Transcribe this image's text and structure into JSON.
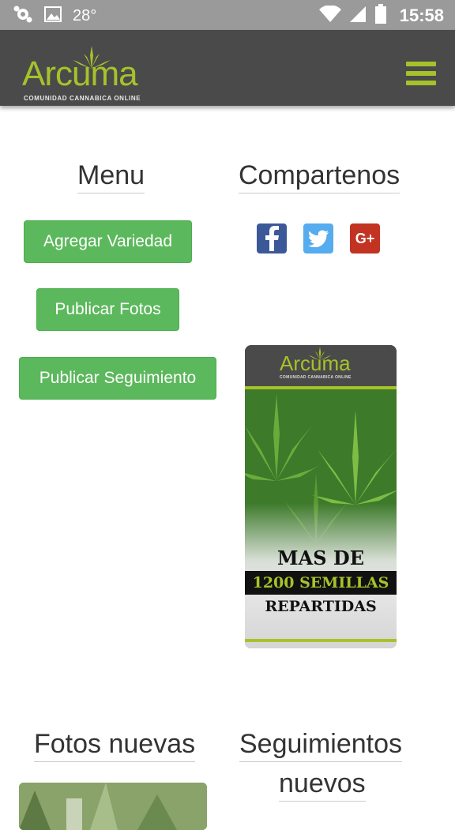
{
  "status_bar": {
    "temperature": "28°",
    "time": "15:58",
    "icons": [
      "app-notification-icon",
      "image-icon",
      "wifi-icon",
      "signal-icon",
      "battery-icon"
    ]
  },
  "header": {
    "logo_word": "Arcuma",
    "logo_tagline": "COMUNIDAD CANNABICA ONLINE",
    "menu_icon": "hamburger-menu-icon"
  },
  "menu": {
    "title": "Menu",
    "buttons": [
      "Agregar Variedad",
      "Publicar Fotos",
      "Publicar Seguimiento"
    ]
  },
  "share": {
    "title": "Compartenos",
    "networks": [
      "facebook-icon",
      "twitter-icon",
      "google-plus-icon"
    ],
    "google_plus_label": "G+"
  },
  "banner": {
    "logo_word": "Arcuma",
    "logo_tagline": "COMUNIDAD CANNABICA ONLINE",
    "line1": "MAS DE",
    "line2": "1200 SEMILLAS",
    "line3": "REPARTIDAS"
  },
  "sections": {
    "photos_title": "Fotos nuevas",
    "tracking_title_1": "Seguimientos",
    "tracking_title_2": "nuevos"
  },
  "colors": {
    "header_bg": "#4a4a4a",
    "brand_green": "#a6c22b",
    "button_green": "#5cb85c"
  }
}
